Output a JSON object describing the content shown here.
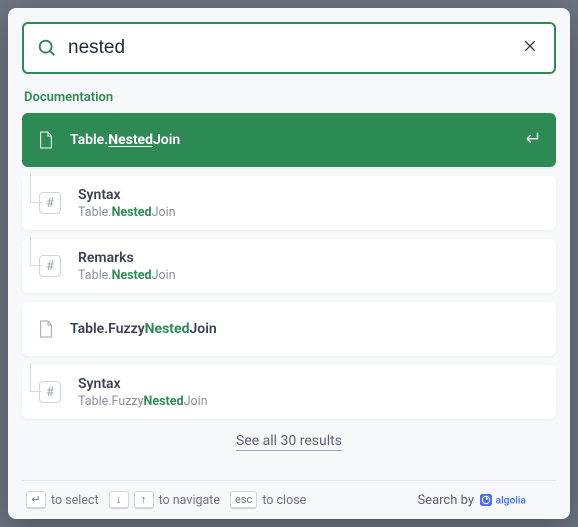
{
  "search": {
    "value": "nested",
    "placeholder": ""
  },
  "section_label": "Documentation",
  "results": [
    {
      "id": "r0",
      "kind": "page",
      "selected": true,
      "title_parts": [
        "Table.",
        "Nested",
        "Join"
      ],
      "hl_index": 1,
      "path_parts": null
    },
    {
      "id": "r1",
      "kind": "anchor",
      "selected": false,
      "title_parts": [
        "Syntax"
      ],
      "hl_index": -1,
      "path_parts": [
        "Table.",
        "Nested",
        "Join"
      ],
      "path_hl_index": 1
    },
    {
      "id": "r2",
      "kind": "anchor",
      "selected": false,
      "title_parts": [
        "Remarks"
      ],
      "hl_index": -1,
      "path_parts": [
        "Table.",
        "Nested",
        "Join"
      ],
      "path_hl_index": 1
    },
    {
      "id": "r3",
      "kind": "page",
      "selected": false,
      "title_parts": [
        "Table.Fuzzy",
        "Nested",
        "Join"
      ],
      "hl_index": 1,
      "path_parts": null
    },
    {
      "id": "r4",
      "kind": "anchor",
      "selected": false,
      "title_parts": [
        "Syntax"
      ],
      "hl_index": -1,
      "path_parts": [
        "Table.Fuzzy",
        "Nested",
        "Join"
      ],
      "path_hl_index": 1
    }
  ],
  "see_all": "See all 30 results",
  "footer": {
    "select_label": "to select",
    "navigate_label": "to navigate",
    "close_label": "to close",
    "search_by": "Search by",
    "esc_key": "esc"
  },
  "icons": {
    "search": "search-icon",
    "clear": "close-icon",
    "file": "file-icon",
    "hash": "hash-icon",
    "enter": "return-icon"
  },
  "colors": {
    "accent": "#2d8a55",
    "modal_bg": "#f7f8f9"
  }
}
